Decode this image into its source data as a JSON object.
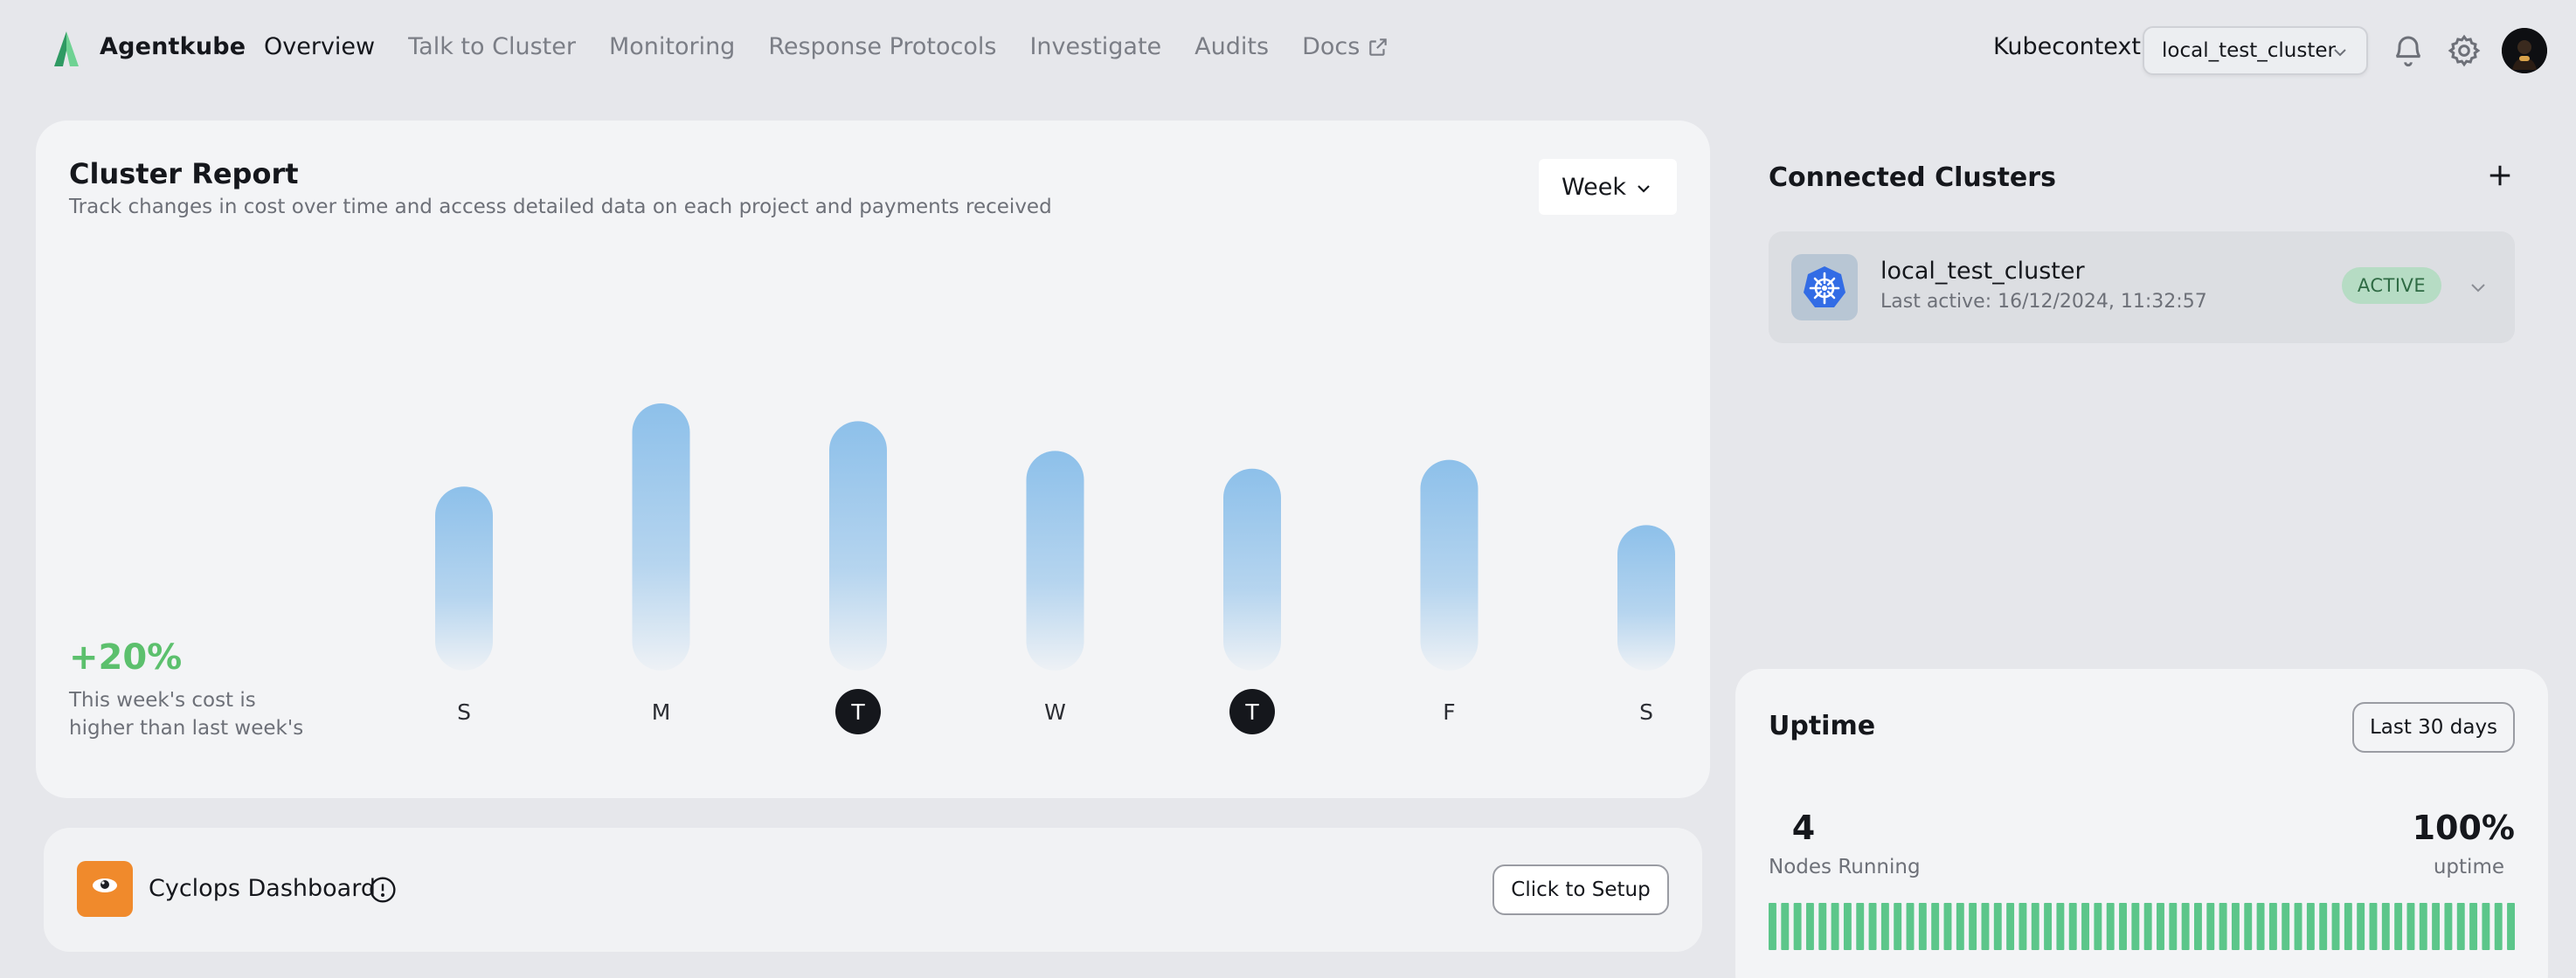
{
  "app": {
    "brand": "Agentkube",
    "brand_color": "#5cc06d"
  },
  "nav": {
    "links": [
      {
        "label": "Overview",
        "active": true
      },
      {
        "label": "Talk to Cluster",
        "active": false
      },
      {
        "label": "Monitoring",
        "active": false
      },
      {
        "label": "Response Protocols",
        "active": false
      },
      {
        "label": "Investigate",
        "active": false
      },
      {
        "label": "Audits",
        "active": false
      },
      {
        "label": "Docs",
        "active": false,
        "icon": "external-link-icon"
      }
    ]
  },
  "header": {
    "kubecontext_label": "Kubecontext",
    "kubecontext_value": "local_test_cluster",
    "icons": [
      "bell-icon",
      "gear-icon",
      "avatar"
    ]
  },
  "report": {
    "title": "Cluster Report",
    "subtitle": "Track changes in cost over time and access detailed data on each project and payments received",
    "range_label": "Week",
    "change": "+20%",
    "change_desc": "This week's cost is higher than last week's"
  },
  "chart_data": {
    "type": "bar",
    "categories": [
      "S",
      "M",
      "T",
      "W",
      "T",
      "F",
      "S"
    ],
    "values": [
      62,
      90,
      84,
      74,
      68,
      71,
      49
    ],
    "highlighted": [
      2,
      4
    ],
    "ylim": [
      0,
      100
    ],
    "bar_color": "#8dc0ea",
    "highlight_color": "#15171c",
    "title": "",
    "xlabel": "",
    "ylabel": "",
    "grid": false
  },
  "cyclops": {
    "name": "Cyclops Dashboard",
    "button_label": "Click to Setup"
  },
  "clusters": {
    "title": "Connected Clusters",
    "items": [
      {
        "name": "local_test_cluster",
        "last_active": "Last active: 16/12/2024, 11:32:57",
        "status": "ACTIVE"
      }
    ]
  },
  "uptime": {
    "title": "Uptime",
    "range_label": "Last 30 days",
    "nodes_value": "4",
    "nodes_label": "Nodes Running",
    "uptime_value": "100%",
    "uptime_label": "uptime",
    "bar_count": 60,
    "bar_color": "#5cc68a"
  }
}
